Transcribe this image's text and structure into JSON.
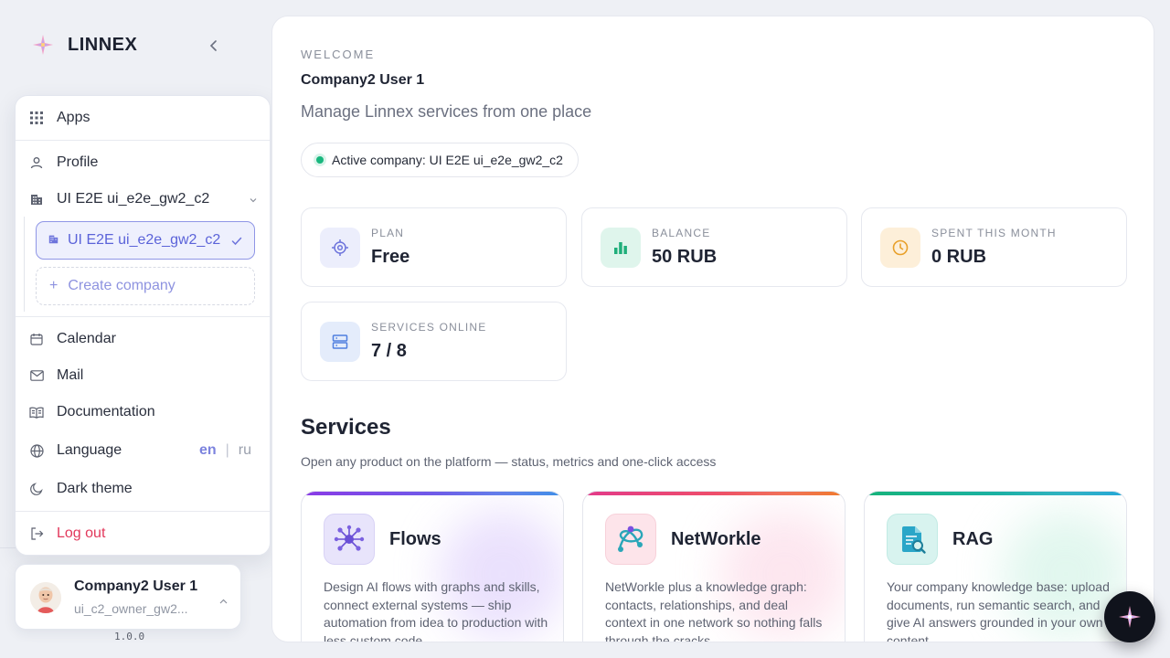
{
  "brand": {
    "name": "LINNEX"
  },
  "menu": {
    "apps": "Apps",
    "profile": "Profile",
    "company_current": "UI E2E ui_e2e_gw2_c2",
    "company_selected": "UI E2E ui_e2e_gw2_c2",
    "create_company": "Create company",
    "calendar": "Calendar",
    "mail": "Mail",
    "documentation": "Documentation",
    "language": "Language",
    "lang_en": "en",
    "lang_sep": "|",
    "lang_ru": "ru",
    "dark_theme": "Dark theme",
    "logout": "Log out"
  },
  "user": {
    "name": "Company2 User 1",
    "email": "ui_c2_owner_gw2..."
  },
  "version": "1.0.0",
  "main": {
    "welcome": "WELCOME",
    "user_title": "Company2 User 1",
    "subtitle": "Manage Linnex services from one place",
    "active_company": "Active company: UI E2E ui_e2e_gw2_c2"
  },
  "stats": {
    "plan": {
      "label": "PLAN",
      "value": "Free"
    },
    "balance": {
      "label": "BALANCE",
      "value": "50 RUB"
    },
    "spent": {
      "label": "SPENT THIS MONTH",
      "value": "0 RUB"
    },
    "services": {
      "label": "SERVICES ONLINE",
      "value": "7 / 8"
    }
  },
  "services": {
    "title": "Services",
    "subtitle": "Open any product on the platform — status, metrics and one-click access",
    "cards": [
      {
        "name": "Flows",
        "desc": "Design AI flows with graphs and skills, connect external systems — ship automation from idea to production with less custom code"
      },
      {
        "name": "NetWorkle",
        "desc": "NetWorkle plus a knowledge graph: contacts, relationships, and deal context in one network so nothing falls through the cracks"
      },
      {
        "name": "RAG",
        "desc": "Your company knowledge base: upload documents, run semantic search, and give AI answers grounded in your own content"
      }
    ]
  },
  "colors": {
    "accent": "#5b63d9",
    "success": "#19b77e",
    "danger": "#e2385b"
  }
}
